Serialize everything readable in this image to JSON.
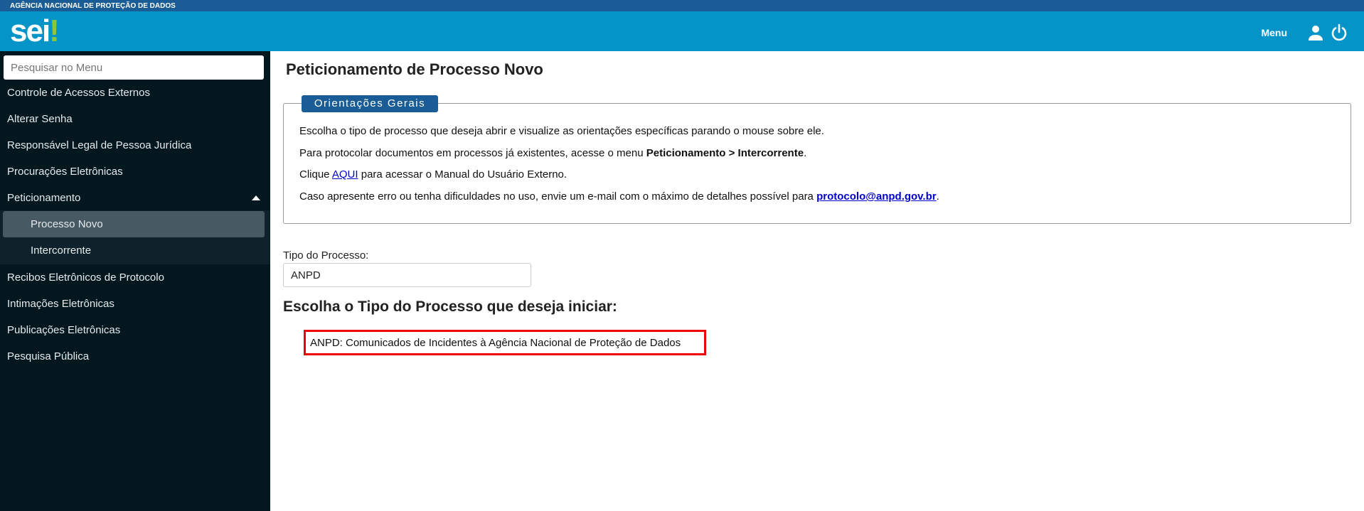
{
  "header": {
    "agency": "AGÊNCIA NACIONAL DE PROTEÇÃO DE DADOS",
    "logo_text": "sei",
    "logo_mark": "!",
    "menu_label": "Menu",
    "icons": [
      "user-icon",
      "power-icon"
    ]
  },
  "sidebar": {
    "search_placeholder": "Pesquisar no Menu",
    "items": [
      {
        "label": "Controle de Acessos Externos"
      },
      {
        "label": "Alterar Senha"
      },
      {
        "label": "Responsável Legal de Pessoa Jurídica"
      },
      {
        "label": "Procurações Eletrônicas"
      },
      {
        "label": "Peticionamento"
      },
      {
        "label": "Processo Novo"
      },
      {
        "label": "Intercorrente"
      },
      {
        "label": "Recibos Eletrônicos de Protocolo"
      },
      {
        "label": "Intimações Eletrônicas"
      },
      {
        "label": "Publicações Eletrônicas"
      },
      {
        "label": "Pesquisa Pública"
      }
    ]
  },
  "main": {
    "title": "Peticionamento de Processo Novo",
    "guidelines": {
      "legend": "Orientações Gerais",
      "line1": "Escolha o tipo de processo que deseja abrir e visualize as orientações específicas parando o mouse sobre ele.",
      "line2_pre": "Para protocolar documentos em processos já existentes, acesse o menu ",
      "line2_bold": "Peticionamento > Intercorrente",
      "line2_post": ".",
      "line3_pre": "Clique ",
      "line3_link": "AQUI",
      "line3_post": " para acessar o Manual do Usuário Externo.",
      "line4_pre": "Caso apresente erro ou tenha dificuldades no uso, envie um e-mail com o máximo de detalhes possível para ",
      "line4_link": "protocolo@anpd.gov.br",
      "line4_post": "."
    },
    "tipo_label": "Tipo do Processo:",
    "tipo_value": "ANPD",
    "choose_heading": "Escolha o Tipo do Processo que deseja iniciar:",
    "options": [
      "ANPD: Comunicados de Incidentes à Agência Nacional de Proteção de Dados"
    ]
  }
}
